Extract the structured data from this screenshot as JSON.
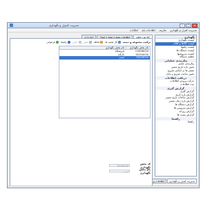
{
  "window": {
    "title": "مدیریت کنترل و نگهداری",
    "controls": {
      "minimize": "–",
      "maximize": "□",
      "close": "×"
    }
  },
  "menu": [
    "مدیریت کنترل و نگهداری",
    "تعاریف",
    "اطلاعات پایه",
    "امکانات"
  ],
  "sidebar": {
    "header": "نگهداری",
    "items_top": [
      "لیست نگهداری",
      "لیست کالاها و اقلام",
      "لیست رقمها",
      "لیست دستگاه ها",
      "لیست سرویسها",
      "تنظیم دستگاه"
    ],
    "group1": "پیکربندی عملیاتی",
    "items_mid": [
      "پیکربندی مسیر",
      "تعیین بازه تاریخ مسیر",
      "مسیر ها بر اساس شروع",
      "تعیین ساعت شروع و پایان"
    ],
    "group2": "دریافت اطلاعات",
    "items_mid2": [
      "حرکت ورودی اطلاعات",
      "ثبت اطلاعات"
    ],
    "group3": "گزارش گیری",
    "items_reports": [
      "گزارش گیری",
      "گزارش بازه تاریخ",
      "گزارش ساعات تاریخ مسیر",
      "گزارش بازه زمان مسیر",
      "گزارش دستگاه ها",
      "گزارش سرویس ها",
      "گزارش روزانه",
      "گزارش پست ها"
    ],
    "group4": "راهنما",
    "items_help": [
      "راهنما"
    ],
    "active_index": 1
  },
  "bottom_tabs": [
    "مدیریت کنترل و نگهداری",
    "اطلاعات پرسنلی"
  ],
  "main": {
    "tabs": [
      "کالا ها و اقلام",
      "اطلاعات شماره شماره اموال",
      "انبارداری"
    ],
    "toolbar": {
      "title": "ترکیب مجموعه و دسته",
      "buttons": {
        "all_branches": "کل شعبه ها",
        "add": "اضافه",
        "edit": "تغییر",
        "delete": "حذف",
        "help": "راهنما",
        "refresh": "بازخوانی"
      }
    },
    "grid": {
      "columns": [
        "نام بخش نگهداری",
        "نام بخش نگهداری"
      ],
      "rows": [
        [
          "C2008C00",
          "فروشگاه"
        ],
        [
          "S0104C00",
          "کارگاه"
        ],
        [
          "70228C00",
          "ایمنی"
        ]
      ],
      "selected_row": 2
    },
    "form": {
      "code_label": "کد بخش نگهداری",
      "code_value": "70228C00",
      "name_label": "نام بخش نگهداری",
      "name_value": "ایمنی"
    }
  },
  "colors": {
    "accent": "#3a74c4",
    "titlebar": "#c5d6ee"
  }
}
